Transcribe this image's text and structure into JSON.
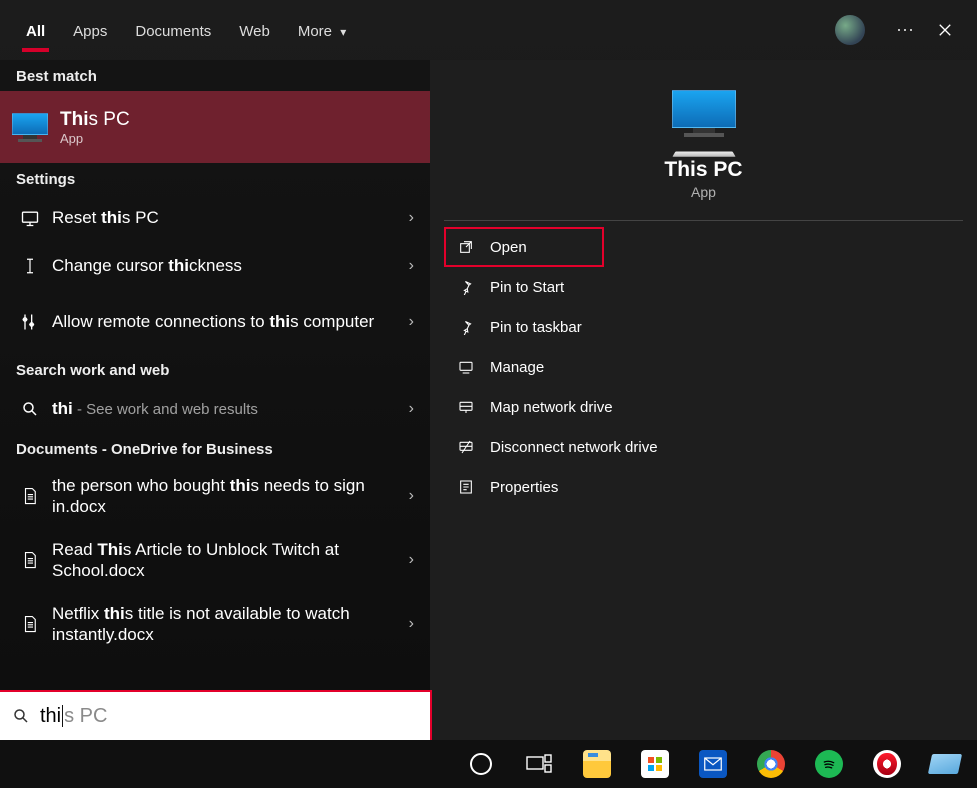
{
  "tabs": {
    "all": "All",
    "apps": "Apps",
    "documents": "Documents",
    "web": "Web",
    "more": "More"
  },
  "sections": {
    "best_match": "Best match",
    "settings": "Settings",
    "search_web": "Search work and web",
    "docs_onedrive": "Documents - OneDrive for Business"
  },
  "best_match": {
    "title_pre_bold": "Thi",
    "title_post": "s PC",
    "subtitle": "App"
  },
  "settings_items": [
    {
      "pre": "Reset ",
      "bold": "thi",
      "post": "s PC"
    },
    {
      "pre": "Change cursor ",
      "bold": "thi",
      "post": "ckness"
    },
    {
      "pre": "Allow remote connections to ",
      "bold": "thi",
      "post": "s computer"
    }
  ],
  "web_item": {
    "bold": "thi",
    "secondary": " - See work and web results"
  },
  "documents": [
    {
      "pre": "the person who bought ",
      "bold": "thi",
      "post": "s needs to sign in.docx"
    },
    {
      "pre": "Read ",
      "bold": "Thi",
      "post": "s Article to Unblock Twitch at School.docx"
    },
    {
      "pre": "Netflix ",
      "bold": "thi",
      "post": "s title is not available to watch instantly.docx"
    }
  ],
  "preview": {
    "title": "This PC",
    "subtitle": "App"
  },
  "actions": {
    "open": "Open",
    "pin_start": "Pin to Start",
    "pin_taskbar": "Pin to taskbar",
    "manage": "Manage",
    "map_drive": "Map network drive",
    "disconnect_drive": "Disconnect network drive",
    "properties": "Properties"
  },
  "search": {
    "typed": "thi",
    "ghost": "s PC"
  }
}
